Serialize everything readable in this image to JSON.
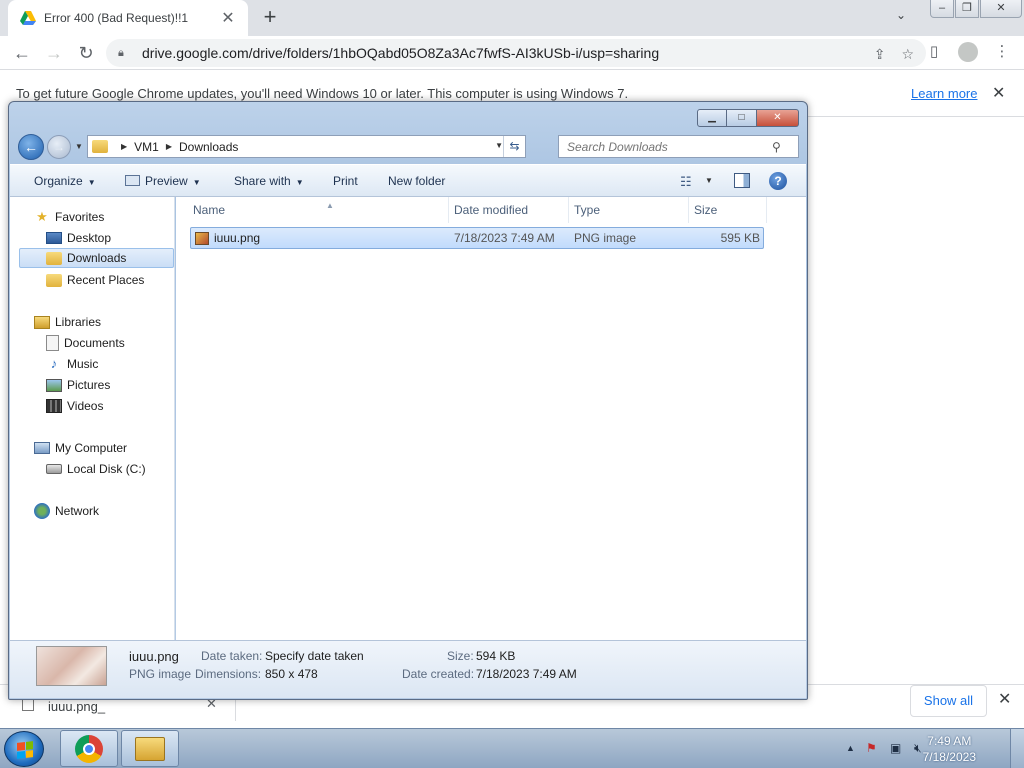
{
  "chrome": {
    "tab_title": "Error 400 (Bad Request)!!1",
    "tab_close": "✕",
    "new_tab": "+",
    "tab_search": "⌄",
    "url": "drive.google.com/drive/folders/1hbOQabd05O8Za3Ac7fwfS-AI3kUSb-i/usp=sharing",
    "infobar_message": "To get future Google Chrome updates, you'll need Windows 10 or later. This computer is using Windows 7.",
    "infobar_link": "Learn more",
    "infobar_close": "✕",
    "download_item": "iuuu.png_",
    "download_chevron": "✕",
    "show_all": "Show all",
    "download_bar_close": "✕"
  },
  "explorer": {
    "breadcrumb": [
      "VM1",
      "Downloads"
    ],
    "search_placeholder": "Search Downloads",
    "commands": {
      "organize": "Organize",
      "preview": "Preview",
      "share_with": "Share with",
      "print": "Print",
      "new_folder": "New folder",
      "help": "?"
    },
    "nav": {
      "favorites": "Favorites",
      "desktop": "Desktop",
      "downloads": "Downloads",
      "recent_places": "Recent Places",
      "libraries": "Libraries",
      "documents": "Documents",
      "music": "Music",
      "pictures": "Pictures",
      "videos": "Videos",
      "my_computer": "My Computer",
      "local_disk": "Local Disk (C:)",
      "network": "Network"
    },
    "columns": {
      "name": "Name",
      "date_modified": "Date modified",
      "type": "Type",
      "size": "Size"
    },
    "files": [
      {
        "name": "iuuu.png",
        "date_modified": "7/18/2023 7:49 AM",
        "type": "PNG image",
        "size": "595 KB"
      }
    ],
    "details": {
      "filename": "iuuu.png",
      "filetype": "PNG image",
      "date_taken_label": "Date taken:",
      "date_taken_value": "Specify date taken",
      "dimensions_label": "Dimensions:",
      "dimensions_value": "850 x 478",
      "size_label": "Size:",
      "size_value": "594 KB",
      "date_created_label": "Date created:",
      "date_created_value": "7/18/2023 7:49 AM"
    }
  },
  "taskbar": {
    "clock_time": "7:49 AM",
    "clock_date": "7/18/2023"
  }
}
